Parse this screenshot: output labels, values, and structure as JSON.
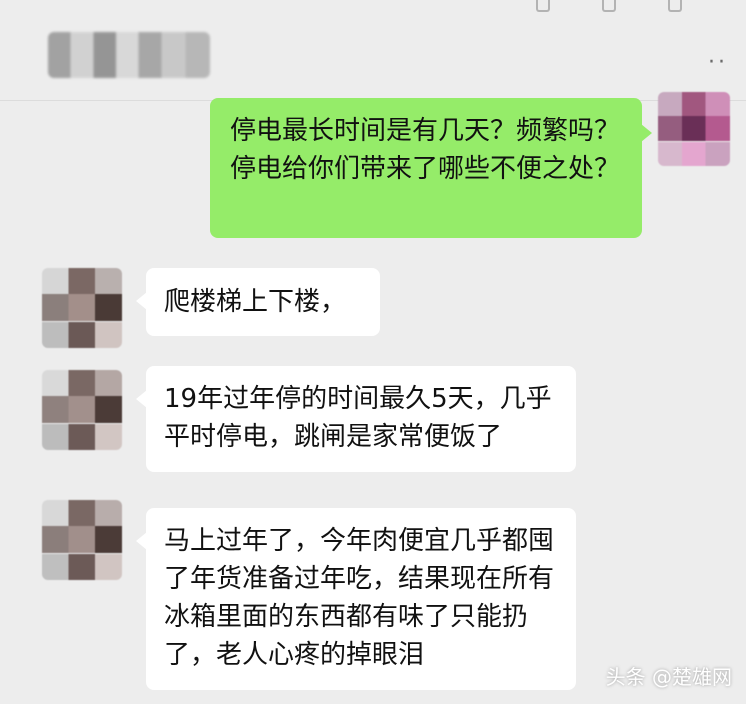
{
  "header": {
    "more_icon": "more-dots-icon",
    "contact_name_blurred": true
  },
  "messages": [
    {
      "direction": "out",
      "text": "停电最长时间是有几天？频繁吗？停电给你们带来了哪些不便之处？"
    },
    {
      "direction": "in",
      "text": "爬楼梯上下楼，"
    },
    {
      "direction": "in",
      "text": "19年过年停的时间最久5天，几乎平时停电，跳闸是家常便饭了"
    },
    {
      "direction": "in",
      "text": "马上过年了，今年肉便宜几乎都囤了年货准备过年吃，结果现在所有冰箱里面的东西都有味了只能扔了，老人心疼的掉眼泪"
    }
  ],
  "watermark": {
    "text": "头条 @楚雄网"
  },
  "colors": {
    "background": "#ededed",
    "outgoing_bubble": "#95ec69",
    "incoming_bubble": "#ffffff"
  }
}
